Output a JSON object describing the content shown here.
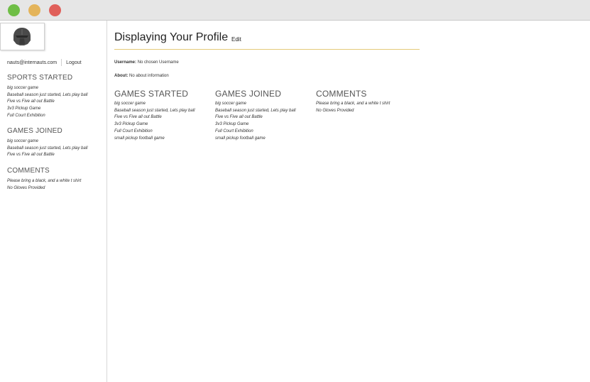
{
  "window": {
    "controls": [
      "green",
      "yellow",
      "red"
    ]
  },
  "sidebar": {
    "avatar_icon": "helmet-avatar-icon",
    "email": "nauts@internauts.com",
    "logout": "Logout",
    "sports_started": {
      "title": "SPORTS STARTED",
      "items": [
        "big soccer game",
        "Baseball season just started, Lets play ball",
        "Five vs Five all out Battle",
        "3v3 Pickup Game",
        "Full Court Exhibition"
      ]
    },
    "games_joined": {
      "title": "GAMES JOINED",
      "items": [
        "big soccer game",
        "Baseball season just started, Lets play ball",
        "Five vs Five all out Battle"
      ]
    },
    "comments": {
      "title": "COMMENTS",
      "items": [
        "Please bring a black, and a white t shirt",
        "No Gloves Provided"
      ]
    }
  },
  "main": {
    "title": "Displaying Your Profile",
    "edit": "Edit",
    "username_label": "Username:",
    "username_value": "No chosen Username",
    "about_label": "About:",
    "about_value": "No about information",
    "games_started": {
      "title": "GAMES STARTED",
      "items": [
        "big soccer game",
        "Baseball season just started, Lets play ball",
        "Five vs Five all out Battle",
        "3v3 Pickup Game",
        "Full Court Exhibition",
        "small pickup football game"
      ]
    },
    "games_joined": {
      "title": "GAMES JOINED",
      "items": [
        "big soccer game",
        "Baseball season just started, Lets play ball",
        "Five vs Five all out Battle",
        "3v3 Pickup Game",
        "Full Court Exhibition",
        "small pickup football game"
      ]
    },
    "comments": {
      "title": "COMMENTS",
      "items": [
        "Please bring a black, and a white t shirt",
        "No Gloves Provided"
      ]
    }
  }
}
